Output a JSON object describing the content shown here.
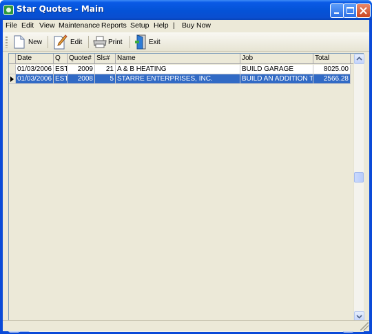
{
  "window": {
    "title": "Star Quotes - Main"
  },
  "menu": [
    "File",
    "Edit",
    "View",
    "Maintenance",
    "Reports",
    "Setup",
    "Help",
    "|",
    "Buy Now"
  ],
  "toolbar": {
    "new_label": "New",
    "edit_label": "Edit",
    "print_label": "Print",
    "exit_label": "Exit"
  },
  "grid": {
    "columns": [
      "Date",
      "Q",
      "Quote#",
      "Sls#",
      "Name",
      "Job",
      "Total"
    ],
    "rows": [
      {
        "date": "01/03/2006",
        "q": "EST",
        "quote": "2009",
        "sls": "21",
        "name": "A & B HEATING",
        "job": "BUILD GARAGE",
        "total": "8025.00",
        "selected": false
      },
      {
        "date": "01/03/2006",
        "q": "EST",
        "quote": "2008",
        "sls": "5",
        "name": "STARRE ENTERPRISES, INC.",
        "job": "BUILD AN ADDITION TO THE BACK OF THE",
        "total": "2566.28",
        "selected": true
      }
    ]
  },
  "colors": {
    "title_blue": "#0453d8",
    "selection": "#316ac5",
    "chrome": "#ece9d8"
  }
}
